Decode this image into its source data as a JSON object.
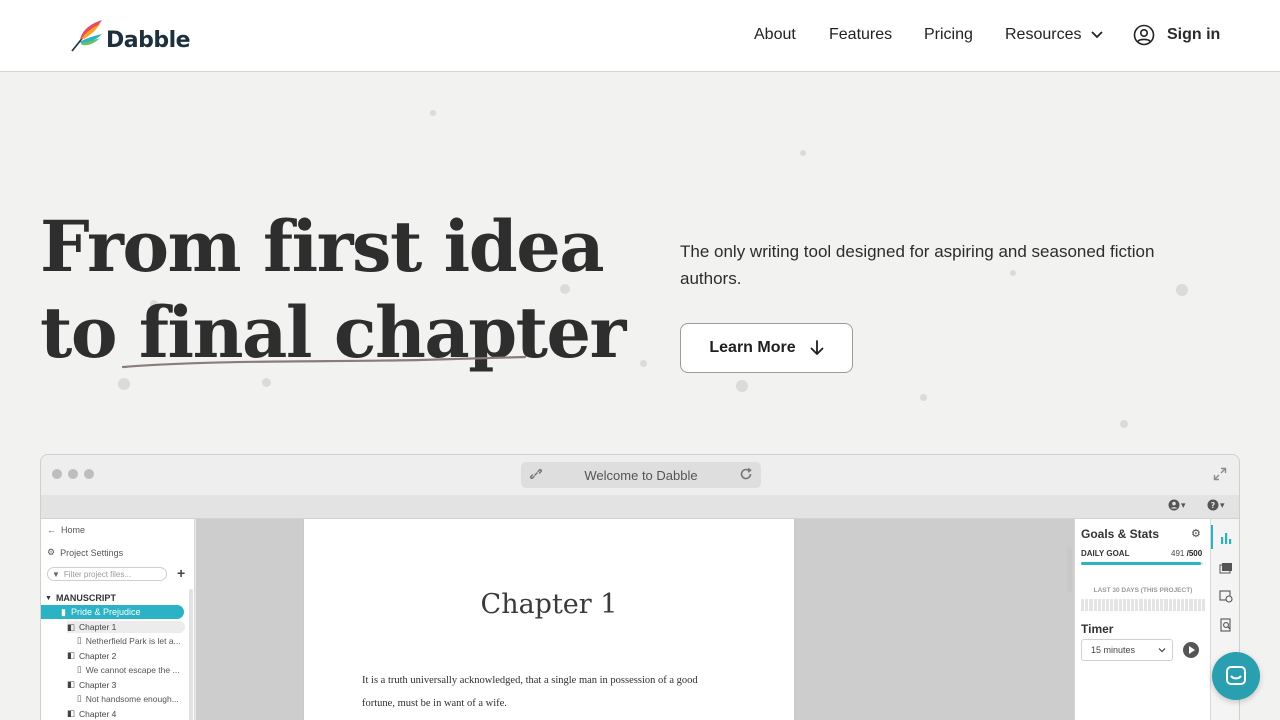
{
  "brand": {
    "name": "Dabble"
  },
  "nav": {
    "about": "About",
    "features": "Features",
    "pricing": "Pricing",
    "resources": "Resources",
    "sign_in": "Sign in"
  },
  "hero": {
    "line1": "From first idea",
    "line2_prefix": "to ",
    "line2_emph": "final chapter",
    "tagline": "The only writing tool designed for aspiring and seasoned fiction authors.",
    "cta": "Learn More"
  },
  "app": {
    "url_title": "Welcome to Dabble",
    "sidebar": {
      "home": "Home",
      "project_settings": "Project Settings",
      "filter_placeholder": "Filter project files...",
      "section": "MANUSCRIPT",
      "book": "Pride & Prejudice",
      "items": [
        {
          "chapter": "Chapter 1",
          "scene": "Netherfield Park is let a..."
        },
        {
          "chapter": "Chapter 2",
          "scene": "We cannot escape the ..."
        },
        {
          "chapter": "Chapter 3",
          "scene": "Not handsome enough..."
        },
        {
          "chapter": "Chapter 4",
          "scene": ""
        }
      ]
    },
    "editor": {
      "chapter_title": "Chapter 1",
      "line1": "It is a truth universally acknowledged, that a single man in possession of a good",
      "line2": "fortune, must be in want of a wife."
    },
    "goals": {
      "title": "Goals & Stats",
      "daily_goal": "DAILY GOAL",
      "current": "491",
      "target": "/500",
      "progress": 0.982,
      "last30": "LAST 30 DAYS (THIS PROJECT)",
      "timer": "Timer",
      "timer_value": "15 minutes"
    }
  },
  "colors": {
    "accent": "#2bb2c4",
    "chat": "#2a9fb0",
    "background": "#f2f2f1"
  }
}
